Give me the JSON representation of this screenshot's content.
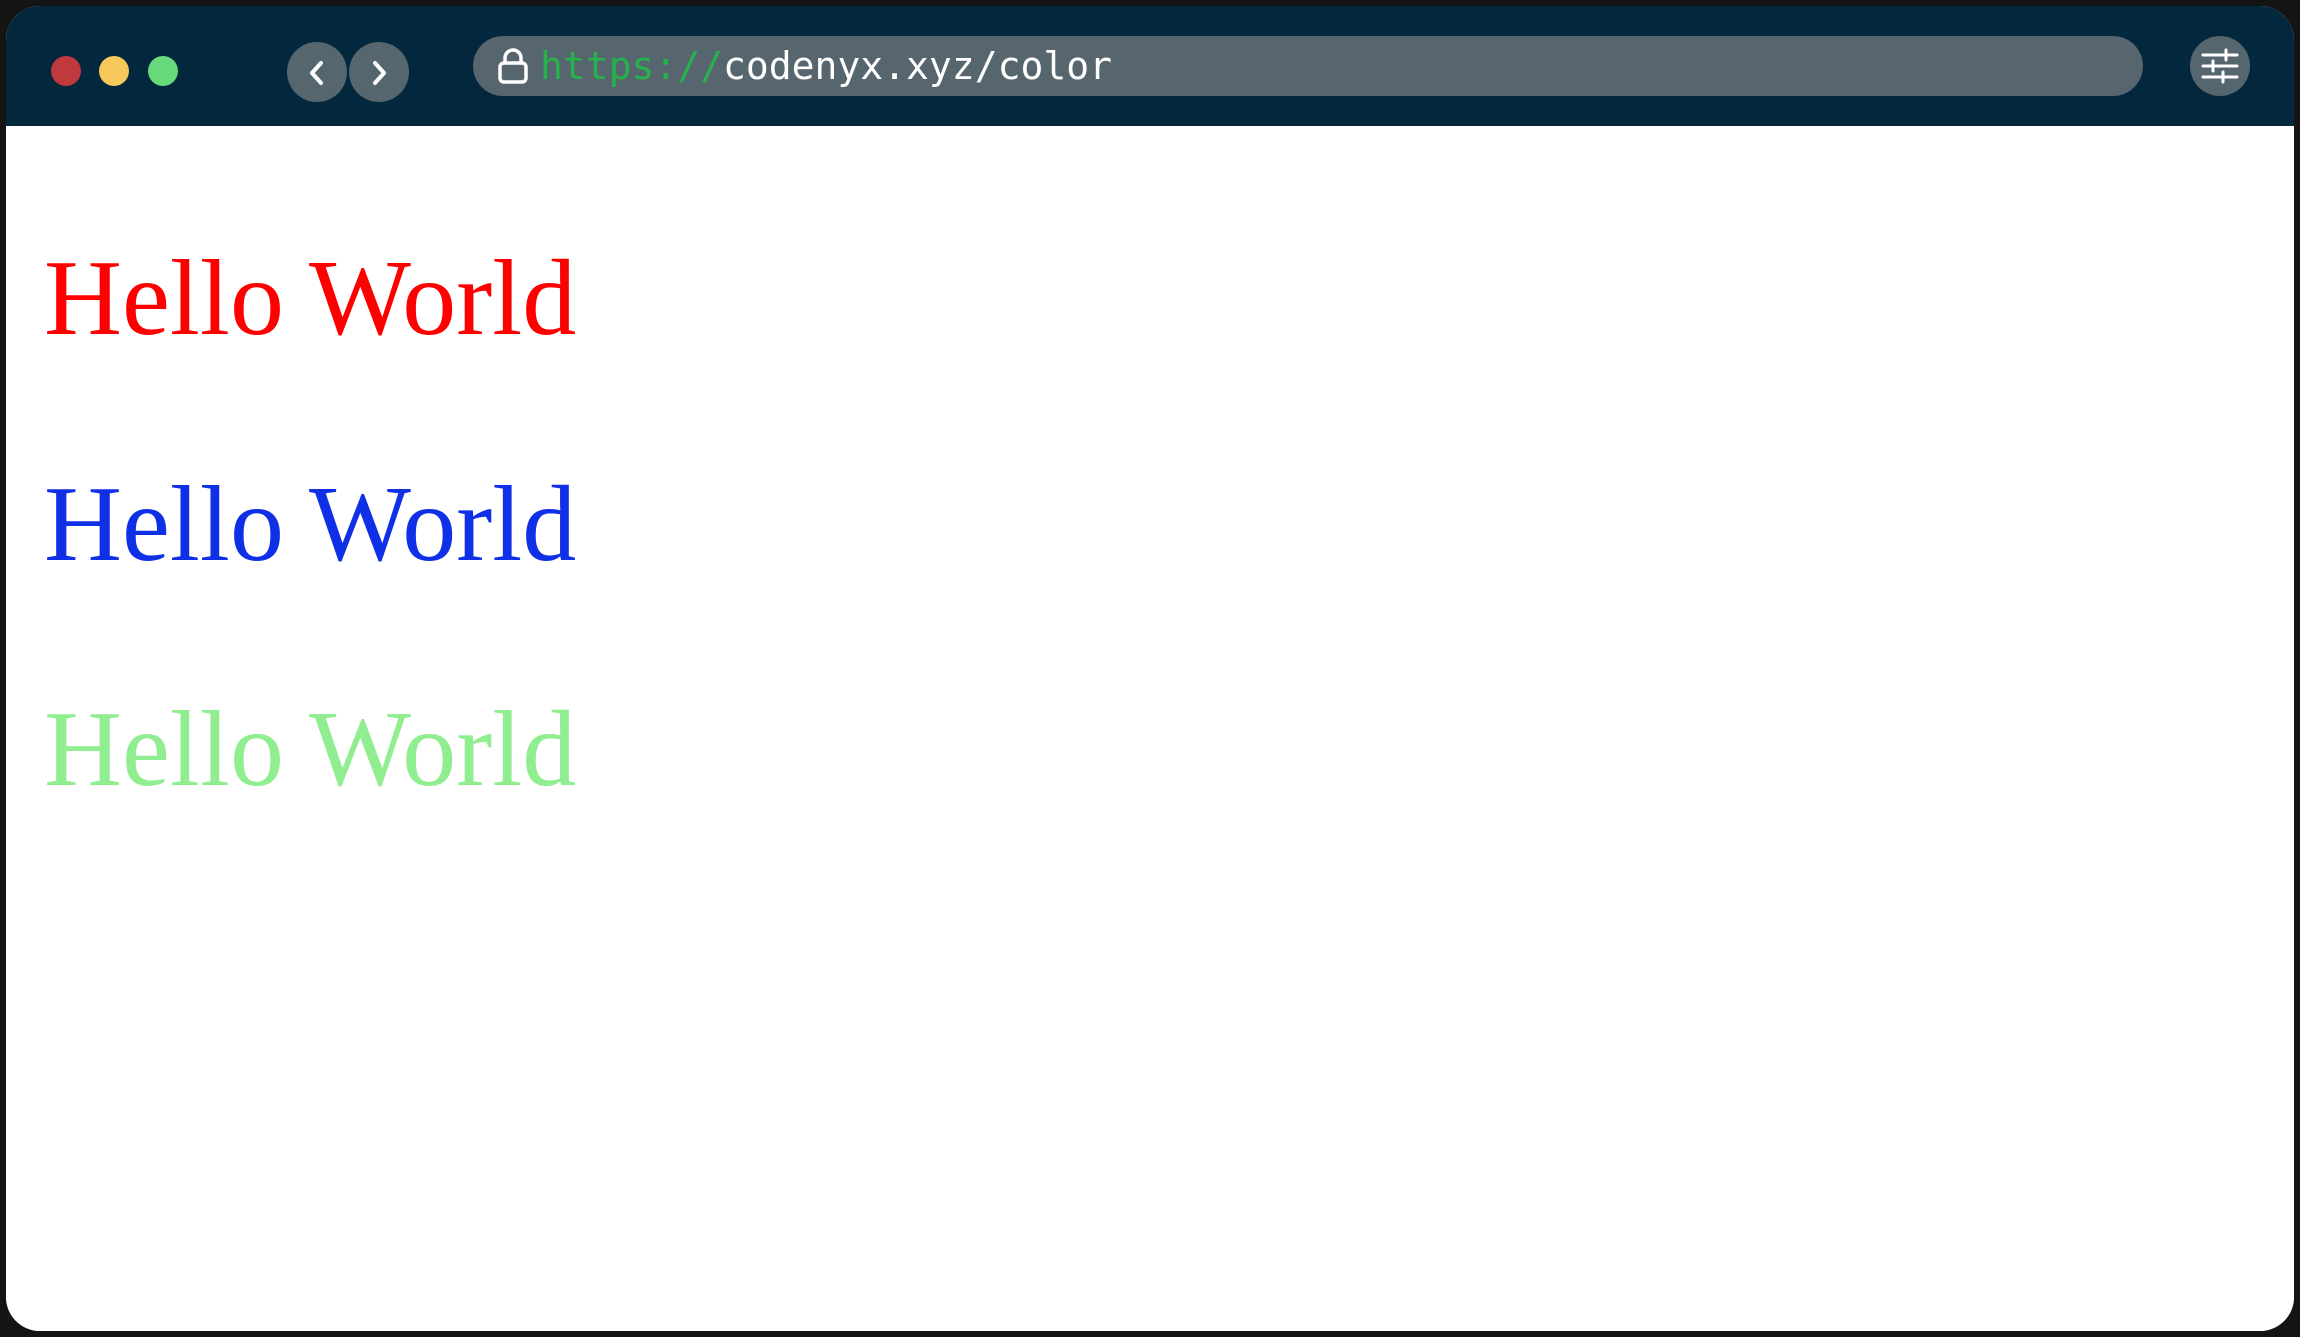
{
  "browser": {
    "url_scheme": "https://",
    "url_rest": "codenyx.xyz/color",
    "traffic_lights": {
      "red": "#c0393c",
      "yellow": "#f7c85c",
      "green": "#67d97b"
    },
    "icons": {
      "back": "chevron-left-icon",
      "forward": "chevron-right-icon",
      "lock": "lock-icon",
      "settings": "sliders-icon"
    }
  },
  "page": {
    "lines": [
      {
        "text": "Hello World",
        "color": "#ff0000"
      },
      {
        "text": "Hello World",
        "color": "#0f30e6"
      },
      {
        "text": "Hello World",
        "color": "#90ee90"
      }
    ]
  }
}
